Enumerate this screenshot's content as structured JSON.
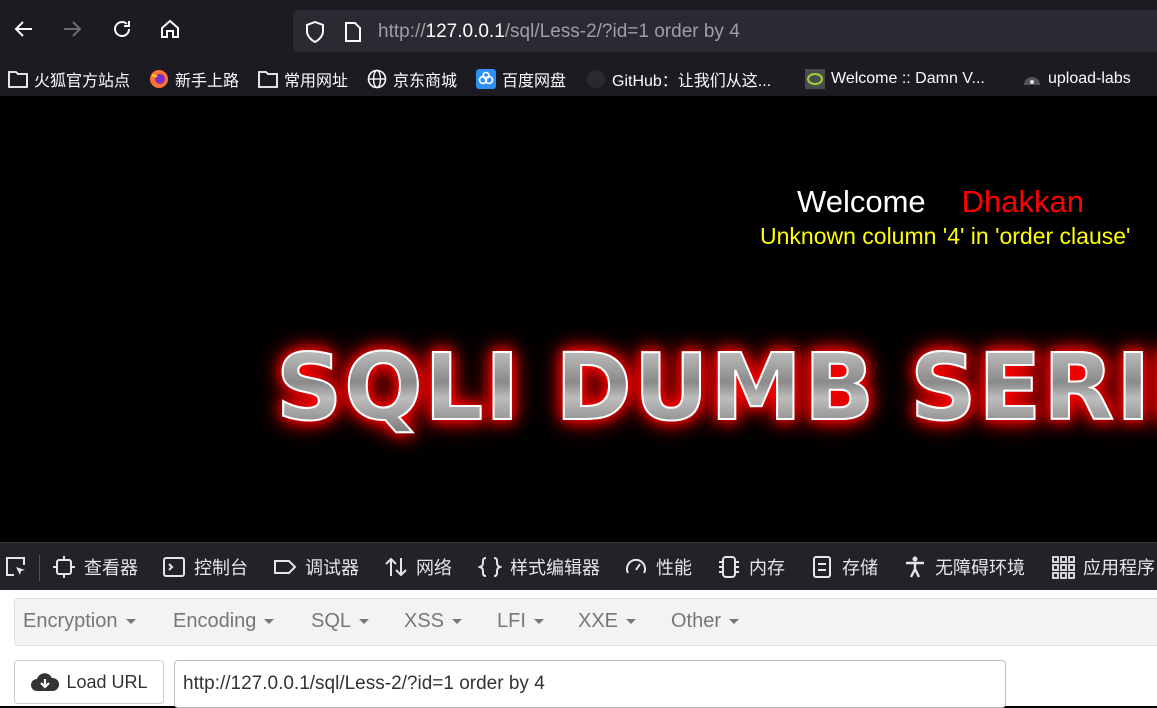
{
  "browser": {
    "url_prefix": "http://",
    "url_host": "127.0.0.1",
    "url_path": "/sql/Less-2/?id=1 order by 4"
  },
  "bookmarks": [
    {
      "label": "火狐官方站点",
      "icon": "folder-icon"
    },
    {
      "label": "新手上路",
      "icon": "firefox-icon"
    },
    {
      "label": "常用网址",
      "icon": "folder-icon"
    },
    {
      "label": "京东商城",
      "icon": "globe-icon"
    },
    {
      "label": "百度网盘",
      "icon": "baidu-cloud-icon"
    },
    {
      "label": "GitHub：让我们从这...",
      "icon": "github-icon"
    },
    {
      "label": "Welcome :: Damn V...",
      "icon": "dvwa-icon"
    },
    {
      "label": "upload-labs",
      "icon": "upload-labs-icon"
    }
  ],
  "page": {
    "welcome_text": "Welcome",
    "user_name": "Dhakkan",
    "error_message": "Unknown column '4' in 'order clause'",
    "banner_text": "SQLI DUMB SERIES"
  },
  "devtools": {
    "tabs": [
      {
        "label": "查看器",
        "icon": "inspector-icon"
      },
      {
        "label": "控制台",
        "icon": "console-icon"
      },
      {
        "label": "调试器",
        "icon": "debugger-icon"
      },
      {
        "label": "网络",
        "icon": "network-icon"
      },
      {
        "label": "样式编辑器",
        "icon": "style-editor-icon"
      },
      {
        "label": "性能",
        "icon": "performance-icon"
      },
      {
        "label": "内存",
        "icon": "memory-icon"
      },
      {
        "label": "存储",
        "icon": "storage-icon"
      },
      {
        "label": "无障碍环境",
        "icon": "accessibility-icon"
      },
      {
        "label": "应用程序",
        "icon": "application-icon"
      }
    ]
  },
  "hackbar": {
    "menus": [
      "Encryption",
      "Encoding",
      "SQL",
      "XSS",
      "LFI",
      "XXE",
      "Other"
    ],
    "load_button": "Load URL",
    "url_value": "http://127.0.0.1/sql/Less-2/?id=1 order by 4"
  },
  "colors": {
    "chrome_bg": "#1c1b22",
    "urlbar_bg": "#2b2a33",
    "welcome_name": "#ff0000",
    "error_text": "#ffff00",
    "banner_glow": "#ff0000"
  }
}
